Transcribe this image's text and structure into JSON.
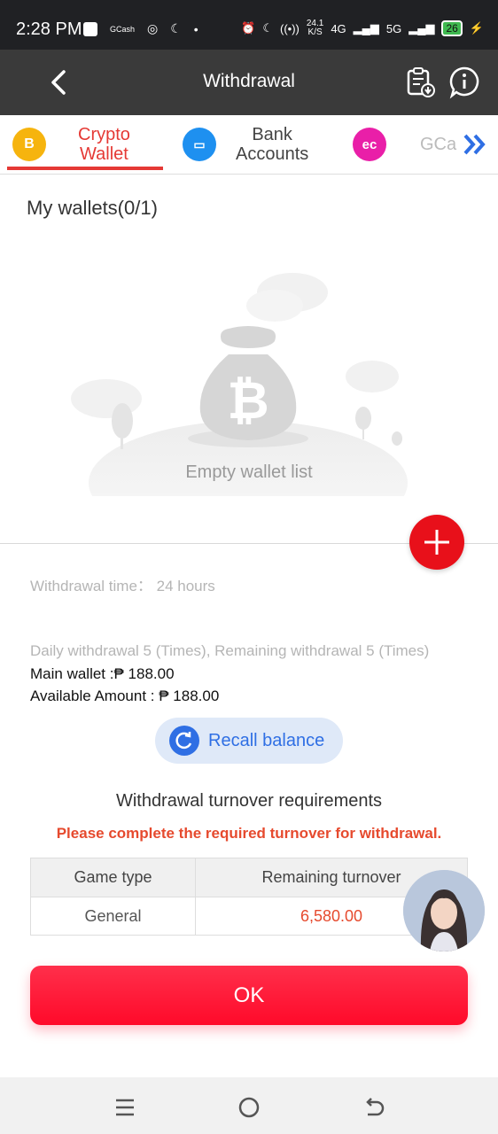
{
  "status": {
    "time": "2:28 PM",
    "speed": "24.1",
    "speed_unit": "K/S",
    "network_1": "4G",
    "network_2": "5G",
    "battery": "26"
  },
  "header": {
    "title": "Withdrawal"
  },
  "tabs": [
    {
      "label": "Crypto\nWallet"
    },
    {
      "label": "Bank\nAccounts"
    },
    {
      "label": "GCa"
    }
  ],
  "wallets": {
    "title": "My wallets(0/1)",
    "empty_text": "Empty wallet list"
  },
  "info": {
    "withdrawal_time": "Withdrawal time：  24 hours",
    "daily_withdrawal": "Daily withdrawal 5 (Times), Remaining withdrawal 5 (Times)",
    "main_wallet": "Main wallet :₱ 188.00",
    "available_amount": "Available Amount : ₱ 188.00"
  },
  "recall": {
    "label": "Recall balance"
  },
  "turnover": {
    "title": "Withdrawal turnover requirements",
    "warning": "Please complete the required turnover for withdrawal.",
    "headers": [
      "Game type",
      "Remaining turnover"
    ],
    "rows": [
      [
        "General",
        "6,580.00"
      ]
    ]
  },
  "ok_label": "OK",
  "colors": {
    "accent": "#e53935",
    "button": "#ff1a36",
    "link": "#2f6fe4"
  }
}
